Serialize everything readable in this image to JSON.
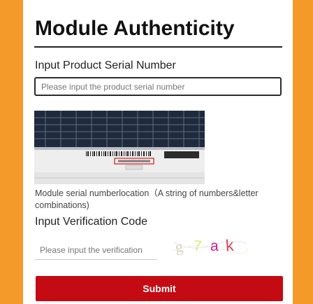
{
  "page": {
    "title": "Module Authenticity",
    "serial_label": "Input Product Serial Number",
    "serial_placeholder": "Please input the product serial number",
    "helper_text": "Module serial numberlocation（A string of numbers&letter combinations)",
    "verify_label": "Input Verification Code",
    "verify_placeholder": "Please input the verification",
    "captcha_text": "g7ak",
    "submit_label": "Submit"
  },
  "colors": {
    "background_orange": "#f39a2b",
    "submit_red": "#c40a12",
    "panel_dark": "#1f2a3c"
  },
  "icons": {
    "panel_image": "solar-panel-label-photo"
  }
}
